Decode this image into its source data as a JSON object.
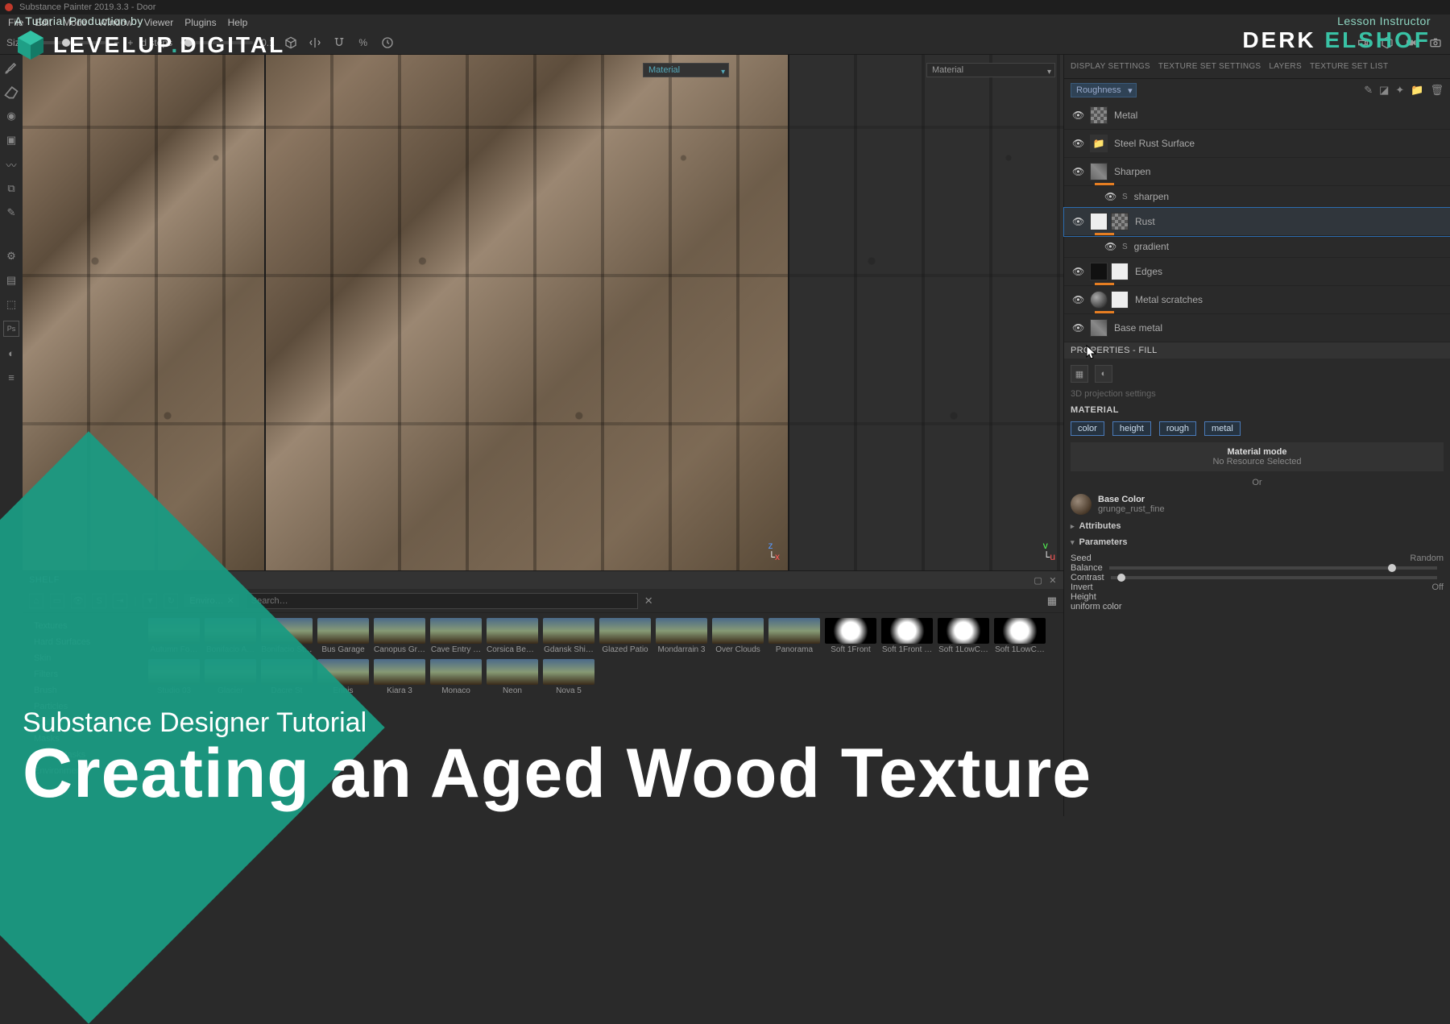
{
  "window": {
    "title": "Substance Painter 2019.3.3 - Door"
  },
  "menu": [
    "File",
    "Edit",
    "Mode",
    "Window",
    "Viewer",
    "Plugins",
    "Help"
  ],
  "toolbar": {
    "size_label": "Size",
    "steps_label": "d steps",
    "steps_value": "0.1"
  },
  "viewport": {
    "material_tag": "Material",
    "material_dd": "Material"
  },
  "right_tabs": [
    "DISPLAY SETTINGS",
    "TEXTURE SET SETTINGS",
    "LAYERS",
    "TEXTURE SET LIST"
  ],
  "channel_dd": "Roughness",
  "layers": [
    {
      "name": "Metal",
      "eye": true,
      "swatch": "pattern"
    },
    {
      "name": "Steel Rust Surface",
      "eye": true,
      "swatch": "folder"
    },
    {
      "name": "Sharpen",
      "eye": true,
      "swatch": "noise",
      "bar": true
    },
    {
      "name": "sharpen",
      "eye": true,
      "sub": true,
      "fx": "S"
    },
    {
      "name": "Rust",
      "eye": true,
      "swatch": "white",
      "bar": true,
      "selected": true,
      "extra": "pattern"
    },
    {
      "name": "gradient",
      "eye": true,
      "sub": true,
      "fx": "S"
    },
    {
      "name": "Edges",
      "eye": true,
      "swatch": "black",
      "bar": true,
      "extra": "white-tri"
    },
    {
      "name": "Metal scratches",
      "eye": true,
      "swatch": "sphere",
      "bar": true,
      "extra": "white-tri"
    },
    {
      "name": "Base metal",
      "eye": true,
      "swatch": "noise"
    }
  ],
  "properties": {
    "header": "PROPERTIES - FILL",
    "proj": "3D projection settings",
    "material": "MATERIAL",
    "channels": [
      "color",
      "height",
      "rough",
      "metal"
    ],
    "mode_title": "Material mode",
    "mode_sub": "No Resource Selected",
    "or": "Or",
    "basecolor_label": "Base Color",
    "basecolor_name": "grunge_rust_fine",
    "attributes": "Attributes",
    "parameters": "Parameters",
    "params": [
      {
        "label": "Seed",
        "right": "Random"
      },
      {
        "label": "Balance",
        "slider": 0.85
      },
      {
        "label": "Contrast",
        "slider": 0.02
      },
      {
        "label": "Invert",
        "right": "Off"
      },
      {
        "label": "Height",
        "right": ""
      },
      {
        "label": "uniform color",
        "right": ""
      }
    ]
  },
  "shelf": {
    "title": "SHELF",
    "filter_tag": "Enviro…",
    "search_ph": "Search…",
    "categories": [
      "Textures",
      "Hard Surfaces",
      "Skin",
      "Filters",
      "Brush",
      "Particles",
      "Tools",
      "Masks",
      "Smart Masks",
      "Environments"
    ],
    "items": [
      "Autumn Fo…",
      "Bonifacio A…",
      "Bonifacio St…",
      "Bus Garage",
      "Canopus Gr…",
      "Cave Entry …",
      "Corsica Bea…",
      "Gdansk Shi…",
      "Glazed Patio",
      "Mondarrain 3",
      "Over Clouds",
      "Panorama",
      "Soft 1Front",
      "Soft 1Front …",
      "Soft 1LowC…",
      "Soft 1LowC…",
      "Studio 03",
      "Glacier",
      "Dacre St",
      "Ennis",
      "Kiara 3",
      "Monaco",
      "Neon",
      "Nova 5"
    ]
  },
  "overlay": {
    "production_by": "A Tutorial Production by",
    "brand_a": "LEVELUP",
    "brand_b": "DIGITAL",
    "instructor_label": "Lesson Instructor",
    "instructor_first": "DERK",
    "instructor_last": "ELSHOF",
    "subtitle": "Substance Designer Tutorial",
    "title": "Creating an Aged Wood Texture"
  }
}
